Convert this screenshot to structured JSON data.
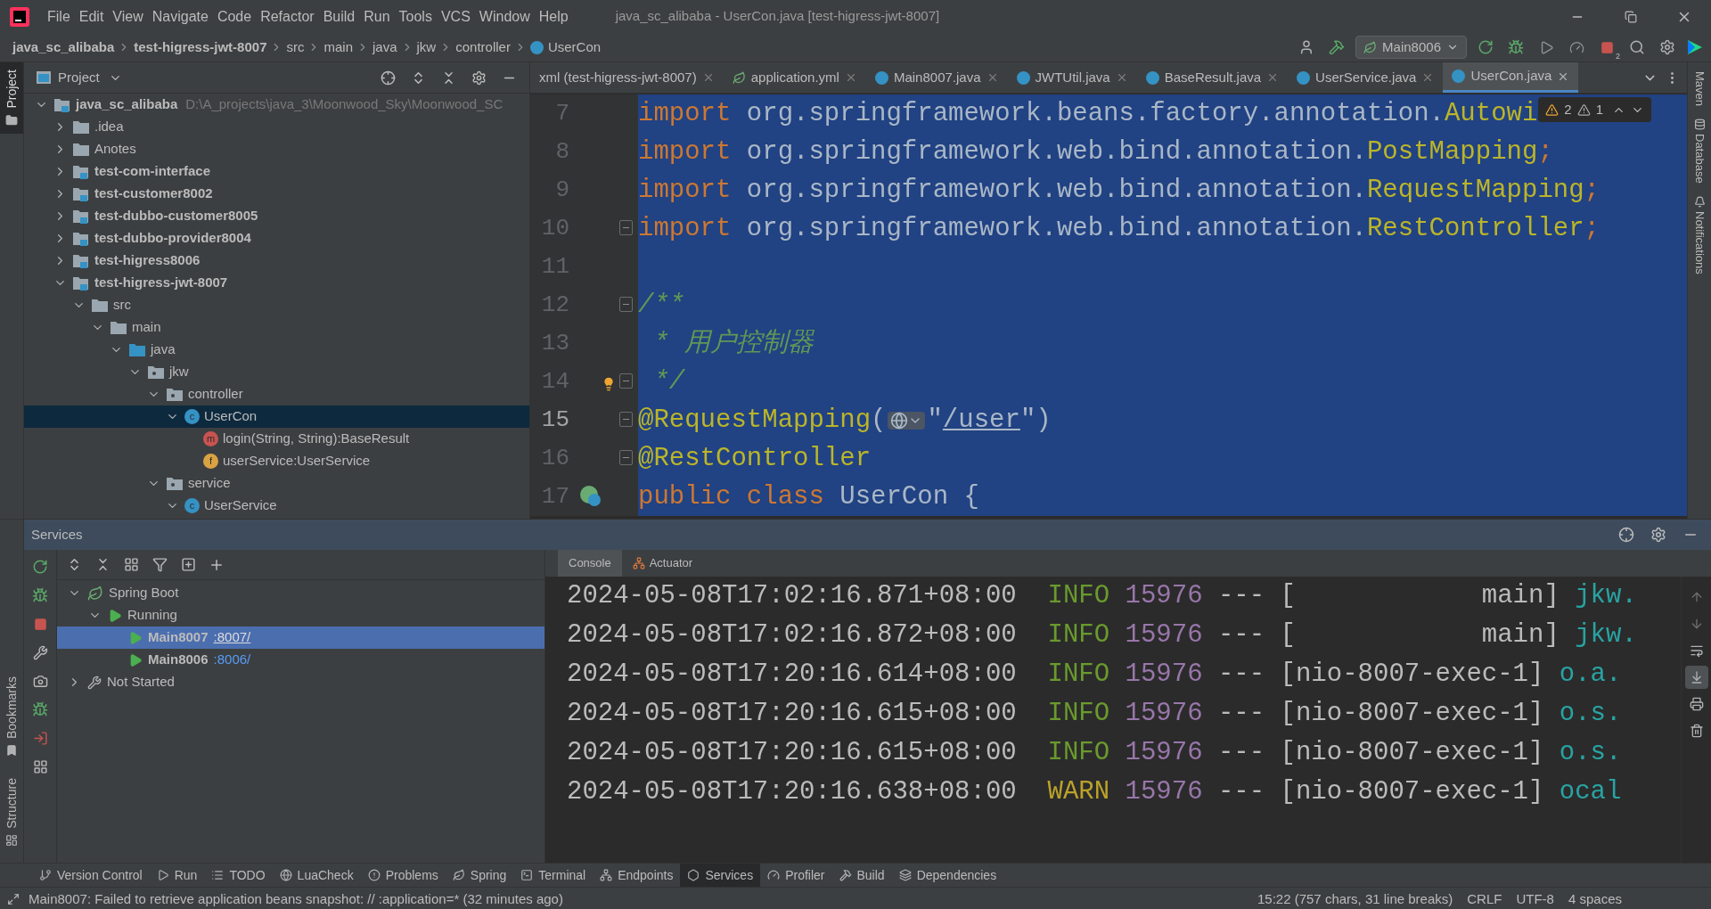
{
  "window": {
    "title": "java_sc_alibaba - UserCon.java [test-higress-jwt-8007]"
  },
  "menu": [
    "File",
    "Edit",
    "View",
    "Navigate",
    "Code",
    "Refactor",
    "Build",
    "Run",
    "Tools",
    "VCS",
    "Window",
    "Help"
  ],
  "breadcrumbs": [
    {
      "label": "java_sc_alibaba",
      "kind": "project"
    },
    {
      "label": "test-higress-jwt-8007",
      "kind": "module"
    },
    {
      "label": "src",
      "kind": "folder"
    },
    {
      "label": "main",
      "kind": "folder"
    },
    {
      "label": "java",
      "kind": "folder"
    },
    {
      "label": "jkw",
      "kind": "folder"
    },
    {
      "label": "controller",
      "kind": "folder"
    },
    {
      "label": "UserCon",
      "kind": "class"
    }
  ],
  "run_config": "Main8006",
  "running_count": "2",
  "left_stripe": [
    {
      "label": "Project",
      "selected": true
    },
    {
      "label": "Bookmarks",
      "selected": false
    },
    {
      "label": "Structure",
      "selected": false
    }
  ],
  "right_stripe": [
    "Maven",
    "Database",
    "Notifications"
  ],
  "project": {
    "title": "Project",
    "tree": [
      {
        "label": "java_sc_alibaba",
        "path": "D:\\A_projects\\java_3\\Moonwood_Sky\\Moonwood_SC",
        "kind": "module",
        "expanded": true,
        "selected": false,
        "children": [
          {
            "label": ".idea",
            "kind": "folder",
            "expanded": false,
            "selected": false
          },
          {
            "label": "Anotes",
            "kind": "folder",
            "expanded": false,
            "selected": false
          },
          {
            "label": "test-com-interface",
            "kind": "module",
            "expanded": false,
            "selected": false
          },
          {
            "label": "test-customer8002",
            "kind": "module",
            "expanded": false,
            "selected": false
          },
          {
            "label": "test-dubbo-customer8005",
            "kind": "module",
            "expanded": false,
            "selected": false
          },
          {
            "label": "test-dubbo-provider8004",
            "kind": "module",
            "expanded": false,
            "selected": false
          },
          {
            "label": "test-higress8006",
            "kind": "module",
            "expanded": false,
            "selected": false
          },
          {
            "label": "test-higress-jwt-8007",
            "kind": "module",
            "expanded": true,
            "selected": false,
            "children": [
              {
                "label": "src",
                "kind": "folder",
                "expanded": true,
                "selected": false,
                "children": [
                  {
                    "label": "main",
                    "kind": "folder",
                    "expanded": true,
                    "selected": false,
                    "children": [
                      {
                        "label": "java",
                        "kind": "source",
                        "expanded": true,
                        "selected": false,
                        "children": [
                          {
                            "label": "jkw",
                            "kind": "package",
                            "expanded": true,
                            "selected": false,
                            "children": [
                              {
                                "label": "controller",
                                "kind": "package",
                                "expanded": true,
                                "selected": false,
                                "children": [
                                  {
                                    "label": "UserCon",
                                    "kind": "class",
                                    "badge": "c",
                                    "expanded": true,
                                    "selected": true,
                                    "children": [
                                      {
                                        "label": "login(String, String):BaseResult",
                                        "kind": "method",
                                        "badge": "m",
                                        "selected": false
                                      },
                                      {
                                        "label": "userService:UserService",
                                        "kind": "field",
                                        "badge": "f",
                                        "selected": false
                                      }
                                    ]
                                  }
                                ]
                              },
                              {
                                "label": "service",
                                "kind": "package",
                                "expanded": true,
                                "selected": false,
                                "children": [
                                  {
                                    "label": "UserService",
                                    "kind": "class",
                                    "badge": "c",
                                    "expanded": true,
                                    "selected": false
                                  }
                                ]
                              }
                            ]
                          }
                        ]
                      }
                    ]
                  }
                ]
              }
            ]
          }
        ]
      }
    ]
  },
  "editor": {
    "tabs": [
      {
        "label": "xml (test-higress-jwt-8007)",
        "kind": "xml",
        "selected": false
      },
      {
        "label": "application.yml",
        "kind": "yaml",
        "selected": false
      },
      {
        "label": "Main8007.java",
        "kind": "class",
        "selected": false
      },
      {
        "label": "JWTUtil.java",
        "kind": "class",
        "selected": false
      },
      {
        "label": "BaseResult.java",
        "kind": "class",
        "selected": false
      },
      {
        "label": "UserService.java",
        "kind": "class",
        "selected": false
      },
      {
        "label": "UserCon.java",
        "kind": "class",
        "selected": true
      }
    ],
    "problems": {
      "warnings": "2",
      "weak_warnings": "1"
    },
    "lines": [
      {
        "number": "7",
        "current": false,
        "tokens": [
          {
            "kind": "kw",
            "text": "import"
          },
          {
            "kind": "plain",
            "text": " org.springframework.beans.factory.annotation."
          },
          {
            "kind": "ann",
            "text": "Autowi"
          }
        ]
      },
      {
        "number": "8",
        "current": false,
        "tokens": [
          {
            "kind": "kw",
            "text": "import"
          },
          {
            "kind": "plain",
            "text": " org.springframework.web.bind.annotation."
          },
          {
            "kind": "ann",
            "text": "PostMapping"
          },
          {
            "kind": "kw",
            "text": ";"
          }
        ]
      },
      {
        "number": "9",
        "current": false,
        "tokens": [
          {
            "kind": "kw",
            "text": "import"
          },
          {
            "kind": "plain",
            "text": " org.springframework.web.bind.annotation."
          },
          {
            "kind": "ann",
            "text": "RequestMapping"
          },
          {
            "kind": "kw",
            "text": ";"
          }
        ]
      },
      {
        "number": "10",
        "current": false,
        "markers": [
          {
            "kind": "fold"
          }
        ],
        "tokens": [
          {
            "kind": "kw",
            "text": "import"
          },
          {
            "kind": "plain",
            "text": " org.springframework.web.bind.annotation."
          },
          {
            "kind": "ann",
            "text": "RestController"
          },
          {
            "kind": "kw",
            "text": ";"
          }
        ]
      },
      {
        "number": "11",
        "current": false
      },
      {
        "number": "12",
        "current": false,
        "markers": [
          {
            "kind": "fold"
          }
        ],
        "tokens": [
          {
            "kind": "cmt",
            "text": "/**"
          }
        ]
      },
      {
        "number": "13",
        "current": false,
        "tokens": [
          {
            "kind": "cmt",
            "text": " * 用户控制器"
          }
        ]
      },
      {
        "number": "14",
        "current": false,
        "markers": [
          {
            "kind": "fold"
          },
          {
            "kind": "bulb"
          }
        ],
        "tokens": [
          {
            "kind": "cmt",
            "text": " */"
          }
        ]
      },
      {
        "number": "15",
        "current": true,
        "markers": [
          {
            "kind": "fold"
          }
        ],
        "tokens": [
          {
            "kind": "ann",
            "text": "@RequestMapping"
          },
          {
            "kind": "plain",
            "text": "("
          },
          {
            "kind": "inlay"
          },
          {
            "kind": "plain",
            "text": "\""
          },
          {
            "kind": "link",
            "text": "/user"
          },
          {
            "kind": "plain",
            "text": "\")"
          }
        ]
      },
      {
        "number": "16",
        "current": false,
        "markers": [
          {
            "kind": "fold"
          }
        ],
        "tokens": [
          {
            "kind": "ann",
            "text": "@RestController"
          }
        ]
      },
      {
        "number": "17",
        "current": false,
        "markers": [
          {
            "kind": "bean"
          }
        ],
        "tokens": [
          {
            "kind": "kw",
            "text": "public class"
          },
          {
            "kind": "plain",
            "text": " UserCon {"
          }
        ]
      }
    ]
  },
  "services": {
    "title": "Services",
    "tree": [
      {
        "label": "Spring Boot",
        "kind": "group",
        "expanded": true,
        "selected": false,
        "children": [
          {
            "label": "Running",
            "kind": "running",
            "expanded": true,
            "selected": false,
            "children": [
              {
                "label": "Main8007",
                "port": ":8007/",
                "kind": "app",
                "selected": true
              },
              {
                "label": "Main8006",
                "port": ":8006/",
                "kind": "app",
                "selected": false
              }
            ]
          }
        ]
      },
      {
        "label": "Not Started",
        "kind": "idle",
        "expanded": false,
        "selected": false
      }
    ],
    "console_tabs": [
      {
        "label": "Console",
        "selected": true
      },
      {
        "label": "Actuator",
        "selected": false
      }
    ],
    "console_tools": [
      {
        "on": false
      },
      {
        "on": false
      },
      {
        "on": false
      },
      {
        "on": true
      },
      {
        "on": false
      },
      {
        "on": false
      }
    ],
    "log": [
      {
        "time": "2024-05-08T17:02:16.871+08:00",
        "level": "INFO",
        "kind": "info",
        "pid": "15976",
        "sep": "---",
        "thread": "[            main]",
        "logger": "jkw."
      },
      {
        "time": "2024-05-08T17:02:16.872+08:00",
        "level": "INFO",
        "kind": "info",
        "pid": "15976",
        "sep": "---",
        "thread": "[            main]",
        "logger": "jkw."
      },
      {
        "time": "2024-05-08T17:20:16.614+08:00",
        "level": "INFO",
        "kind": "info",
        "pid": "15976",
        "sep": "---",
        "thread": "[nio-8007-exec-1]",
        "logger": "o.a."
      },
      {
        "time": "2024-05-08T17:20:16.615+08:00",
        "level": "INFO",
        "kind": "info",
        "pid": "15976",
        "sep": "---",
        "thread": "[nio-8007-exec-1]",
        "logger": "o.s."
      },
      {
        "time": "2024-05-08T17:20:16.615+08:00",
        "level": "INFO",
        "kind": "info",
        "pid": "15976",
        "sep": "---",
        "thread": "[nio-8007-exec-1]",
        "logger": "o.s."
      },
      {
        "time": "2024-05-08T17:20:16.638+08:00",
        "level": "WARN",
        "kind": "warn",
        "pid": "15976",
        "sep": "---",
        "thread": "[nio-8007-exec-1]",
        "logger": "ocal"
      }
    ]
  },
  "tool_tabs": [
    {
      "label": "Version Control",
      "selected": false
    },
    {
      "label": "Run",
      "selected": false
    },
    {
      "label": "TODO",
      "selected": false
    },
    {
      "label": "LuaCheck",
      "selected": false
    },
    {
      "label": "Problems",
      "selected": false
    },
    {
      "label": "Spring",
      "selected": false
    },
    {
      "label": "Terminal",
      "selected": false
    },
    {
      "label": "Endpoints",
      "selected": false
    },
    {
      "label": "Services",
      "selected": true
    },
    {
      "label": "Profiler",
      "selected": false
    },
    {
      "label": "Build",
      "selected": false
    },
    {
      "label": "Dependencies",
      "selected": false
    }
  ],
  "status": {
    "message": "Main8007: Failed to retrieve application beans snapshot: // :application=* (32 minutes ago)",
    "position": "15:22 (757 chars, 31 line breaks)",
    "line_separator": "CRLF",
    "encoding": "UTF-8",
    "indent": "4 spaces"
  }
}
